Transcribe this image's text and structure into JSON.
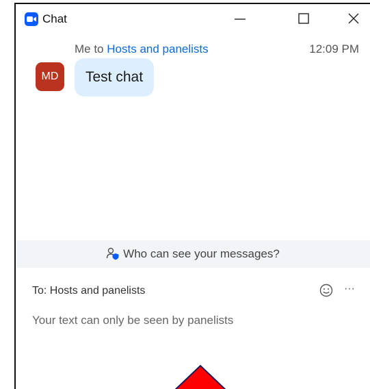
{
  "window": {
    "title": "Chat"
  },
  "message": {
    "sender_prefix": "Me to",
    "recipient": "Hosts and panelists",
    "time": "12:09 PM",
    "avatar_initials": "MD",
    "text": "Test chat"
  },
  "privacy": {
    "text": "Who can see your messages?"
  },
  "composer": {
    "to_label": "To:",
    "to_value": "Hosts and panelists",
    "placeholder": "Your text can only be seen by panelists",
    "more_label": "···"
  },
  "colors": {
    "accent": "#0b5cff",
    "avatar": "#b9331f",
    "bubble": "#ddeeff",
    "link": "#0e6ad6",
    "marker": "#ff0000"
  },
  "icons": [
    "zoom-chat-icon",
    "minimize-icon",
    "maximize-icon",
    "close-icon",
    "people-shield-icon",
    "emoji-icon",
    "more-icon"
  ]
}
